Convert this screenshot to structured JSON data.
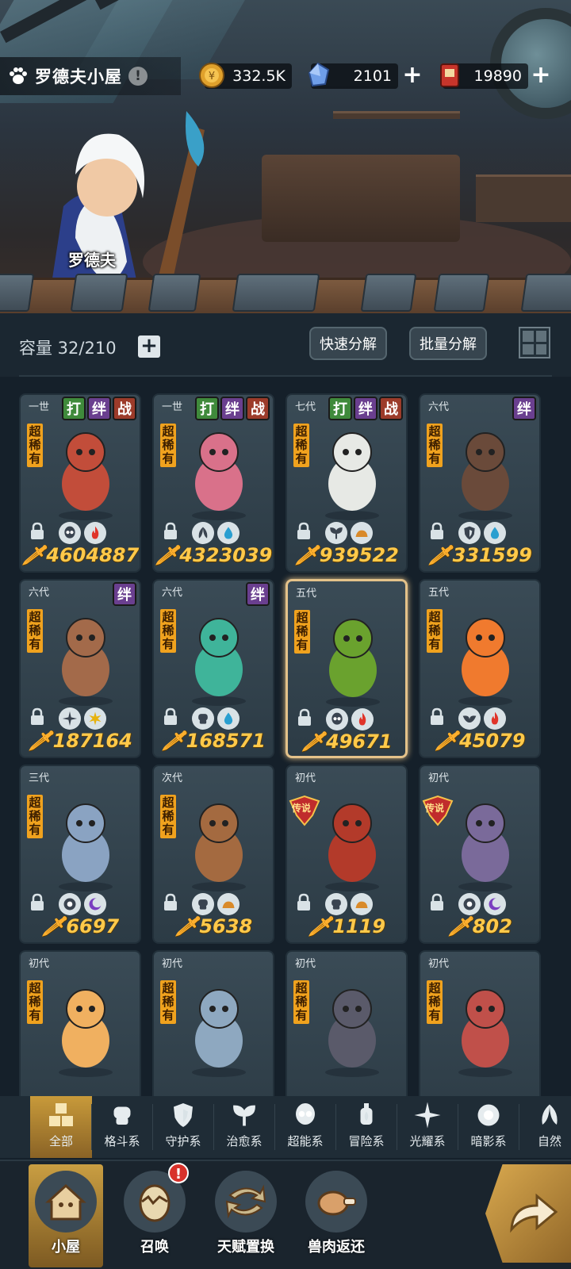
{
  "header": {
    "house_name": "罗德夫小屋",
    "info": "!",
    "npc_name": "罗德夫",
    "resources": [
      {
        "icon": "gold-coin-icon",
        "value": "332.5K"
      },
      {
        "icon": "crystal-icon",
        "value": "2101"
      },
      {
        "icon": "ticket-icon",
        "value": "19890"
      }
    ],
    "plus": "+"
  },
  "toolbar": {
    "capacity_label": "容量 32/210",
    "add": "+",
    "quick_dismantle": "快速分解",
    "batch_dismantle": "批量分解"
  },
  "pets": [
    {
      "gen": "一世",
      "tags": [
        "打",
        "绊",
        "战"
      ],
      "rarity": "超稀有",
      "power": "4604887",
      "elements": [
        "psychic-icon",
        "fire-icon"
      ],
      "locked": true
    },
    {
      "gen": "一世",
      "tags": [
        "打",
        "绊",
        "战"
      ],
      "rarity": "超稀有",
      "power": "4323039",
      "elements": [
        "leaf-wing-icon",
        "water-icon"
      ],
      "locked": true
    },
    {
      "gen": "七代",
      "tags": [
        "打",
        "绊",
        "战"
      ],
      "rarity": "超稀有",
      "power": "939522",
      "elements": [
        "sprout-icon",
        "earth-icon"
      ],
      "locked": true
    },
    {
      "gen": "六代",
      "tags": [
        "绊"
      ],
      "rarity": "超稀有",
      "power": "331599",
      "elements": [
        "shield-icon",
        "water-icon"
      ],
      "locked": true
    },
    {
      "gen": "六代",
      "tags": [
        "绊"
      ],
      "rarity": "超稀有",
      "power": "187164",
      "elements": [
        "light-icon",
        "sun-icon"
      ],
      "locked": true
    },
    {
      "gen": "六代",
      "tags": [
        "绊"
      ],
      "rarity": "超稀有",
      "power": "168571",
      "elements": [
        "fist-icon",
        "water-icon"
      ],
      "locked": true
    },
    {
      "gen": "五代",
      "tags": [],
      "rarity": "超稀有",
      "power": "49671",
      "elements": [
        "psychic-icon",
        "fire-icon"
      ],
      "locked": true,
      "selected": true
    },
    {
      "gen": "五代",
      "tags": [],
      "rarity": "超稀有",
      "power": "45079",
      "elements": [
        "wing-icon",
        "fire-icon"
      ],
      "locked": true
    },
    {
      "gen": "三代",
      "tags": [],
      "rarity": "超稀有",
      "power": "6697",
      "elements": [
        "eye-icon",
        "moon-icon"
      ],
      "locked": true
    },
    {
      "gen": "次代",
      "tags": [],
      "rarity": "超稀有",
      "power": "5638",
      "elements": [
        "fist-icon",
        "earth-icon"
      ],
      "locked": true
    },
    {
      "gen": "初代",
      "tags": [],
      "rarity": "传说",
      "power": "1119",
      "elements": [
        "fist-icon",
        "earth-icon"
      ],
      "locked": true,
      "legend": true
    },
    {
      "gen": "初代",
      "tags": [],
      "rarity": "传说",
      "power": "802",
      "elements": [
        "eye-icon",
        "moon-icon"
      ],
      "locked": true,
      "legend": true
    },
    {
      "gen": "初代",
      "tags": [],
      "rarity": "超稀有",
      "power": "",
      "elements": [],
      "locked": false
    },
    {
      "gen": "初代",
      "tags": [],
      "rarity": "超稀有",
      "power": "",
      "elements": [],
      "locked": false
    },
    {
      "gen": "初代",
      "tags": [],
      "rarity": "超稀有",
      "power": "",
      "elements": [],
      "locked": false
    },
    {
      "gen": "初代",
      "tags": [],
      "rarity": "超稀有",
      "power": "",
      "elements": [],
      "locked": false
    }
  ],
  "filters": [
    {
      "label": "全部",
      "icon": "all-blocks-icon",
      "active": true
    },
    {
      "label": "格斗系",
      "icon": "fist-icon"
    },
    {
      "label": "守护系",
      "icon": "shield-icon"
    },
    {
      "label": "治愈系",
      "icon": "sprout-icon"
    },
    {
      "label": "超能系",
      "icon": "psychic-icon"
    },
    {
      "label": "冒险系",
      "icon": "lantern-icon"
    },
    {
      "label": "光耀系",
      "icon": "light-icon"
    },
    {
      "label": "暗影系",
      "icon": "eye-icon"
    },
    {
      "label": "自然",
      "icon": "leaf-wing-icon"
    }
  ],
  "nav": [
    {
      "label": "小屋",
      "icon": "house-icon",
      "active": true
    },
    {
      "label": "召唤",
      "icon": "egg-icon",
      "alert": "!"
    },
    {
      "label": "天赋置换",
      "icon": "swap-arrows-icon"
    },
    {
      "label": "兽肉返还",
      "icon": "meat-icon"
    }
  ],
  "colors": {
    "accent_gold": "#ffc94a",
    "selected_border": "#e4c28a",
    "tag_green": "#3f8a3b",
    "tag_purple": "#6a3f8f",
    "tag_red": "#9c3b2a",
    "rarity_orange": "#f0a21e"
  }
}
